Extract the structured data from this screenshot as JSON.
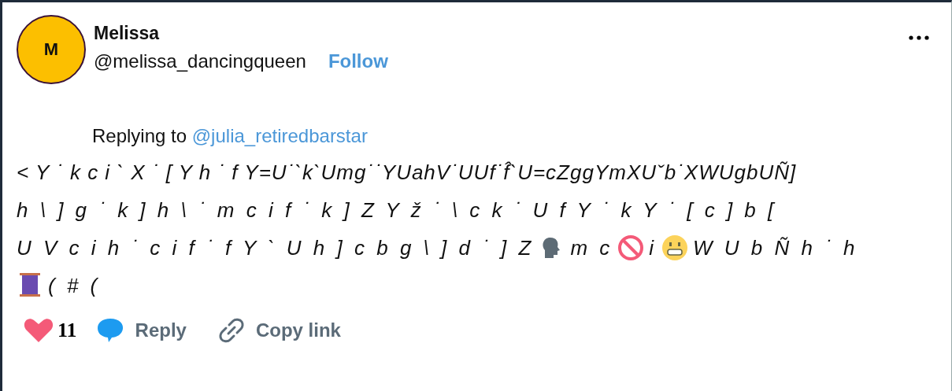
{
  "author": {
    "initial": "M",
    "name": "Melissa",
    "handle": "@melissa_dancingqueen",
    "follow": "Follow"
  },
  "reply": {
    "prefix": "Replying to",
    "target": "@julia_retiredbarstar"
  },
  "body": {
    "line_1": "< Y ˙ k c i ` X ˙ [ Y h ˙ f Y=U˙`k`Umg˙˙YUahV˙UUf˙f̂`U=cZggYmXUˇb˙XWUgbUÑ]",
    "line_2": "h \\ ] g ˙ k ] h \\ ˙ m c i f ˙ k ] Z Y ž ˙ \\ c k ˙ U f Y ˙ k Y ˙ [ c ] b [",
    "line_3": [
      "U V c i h ˙ c i f ˙ f Y ` U h ] c b g \\ ] d ˙ ] Z",
      "m c",
      "i",
      "W U b Ñ h ˙ h"
    ],
    "line_4": "( # ("
  },
  "actions": {
    "likes": "11",
    "reply": "Reply",
    "copy": "Copy link"
  }
}
